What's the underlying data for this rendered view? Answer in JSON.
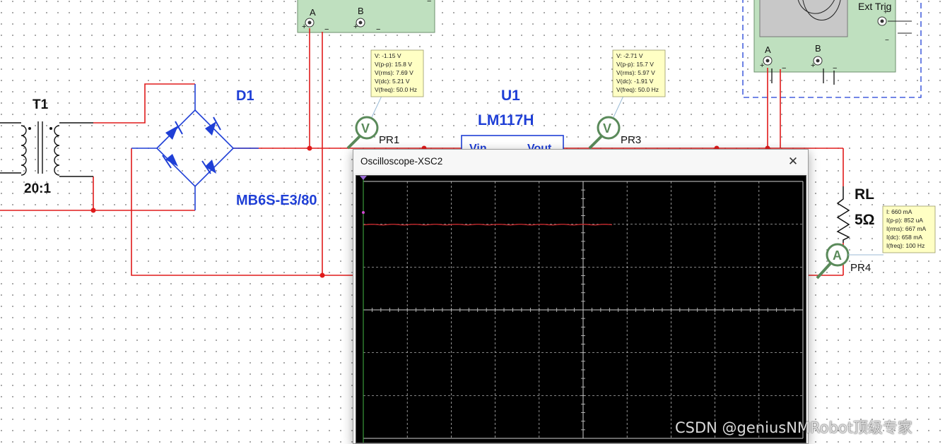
{
  "schematic": {
    "transformer": {
      "ref": "T1",
      "ratio": "20:1"
    },
    "bridge": {
      "ref": "D1",
      "part": "MB6S-E3/80"
    },
    "regulator": {
      "ref": "U1",
      "part": "LM117H",
      "pin_in": "Vin",
      "pin_out": "Vout"
    },
    "load": {
      "ref": "RL",
      "value": "5Ω"
    },
    "probes": [
      {
        "ref": "PR1",
        "symbol": "V"
      },
      {
        "ref": "PR3",
        "symbol": "V"
      },
      {
        "ref": "PR4",
        "symbol": "A"
      }
    ],
    "scope_left": {
      "ch_a": "A",
      "ch_b": "B"
    },
    "scope_right": {
      "ch_a": "A",
      "ch_b": "B",
      "ext_trig": "Ext Trig"
    }
  },
  "probe_readouts": {
    "pr1": [
      "V: -1.15 V",
      "V(p-p): 15.8 V",
      "V(rms): 7.69 V",
      "V(dc): 5.21 V",
      "V(freq): 50.0 Hz"
    ],
    "pr3": [
      "V: -2.71 V",
      "V(p-p): 15.7 V",
      "V(rms): 5.97 V",
      "V(dc): -1.91 V",
      "V(freq): 50.0 Hz"
    ],
    "pr4": [
      "I: 660 mA",
      "I(p-p): 852 uA",
      "I(rms): 667 mA",
      "I(dc): 658 mA",
      "I(freq): 100 Hz"
    ]
  },
  "oscilloscope": {
    "title": "Oscilloscope-XSC2",
    "close_label": "✕",
    "trace_color": "#c0282c",
    "screen_bg": "#000000",
    "grid_color": "#d0d0d0",
    "trace_level_fraction": 0.183,
    "trace_extent_fraction": 0.57
  },
  "colors": {
    "wire": "#e01b1b",
    "component": "#1f3fd6",
    "probe": "#5a8a5a",
    "instrument_bg": "#bfe0bf"
  },
  "watermark": "CSDN @geniusNMRobot顶级专家"
}
